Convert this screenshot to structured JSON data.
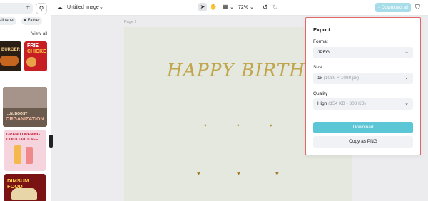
{
  "left_panel": {
    "chips": [
      "allpaper",
      "Father"
    ],
    "view_all": "View all",
    "templates": [
      {
        "line1": "BURGER",
        "line2": ""
      },
      {
        "line1": "FRIE",
        "line2": "CHICKE"
      },
      {
        "line1": "...N, BOOST",
        "line2": "ORGANIZATION"
      },
      {
        "line1": "GRAND OPENING",
        "line2": "COCKTAIL CAFE"
      },
      {
        "line1": "DIMSUM FOOD",
        "line2": ""
      }
    ]
  },
  "topbar": {
    "title": "Untitled image",
    "zoom": "72%",
    "download_all": "Download all"
  },
  "canvas": {
    "page_label": "Page 1",
    "greeting": "HAPPY BIRTHDAY"
  },
  "export_panel": {
    "title": "Export",
    "format": {
      "label": "Format",
      "value": "JPEG"
    },
    "size": {
      "label": "Size",
      "value": "1x",
      "detail": "(1080 × 1080 px)"
    },
    "quality": {
      "label": "Quality",
      "value": "High",
      "detail": "(154 KB - 308 KB)"
    },
    "download_button": "Download",
    "copy_button": "Copy as PNG"
  },
  "colors": {
    "accent": "#5bc6d5",
    "accent_disabled": "#a6dde8",
    "canvas_bg": "#e4e8de",
    "greeting": "#c1a54a",
    "panel_border": "#e0686a"
  }
}
